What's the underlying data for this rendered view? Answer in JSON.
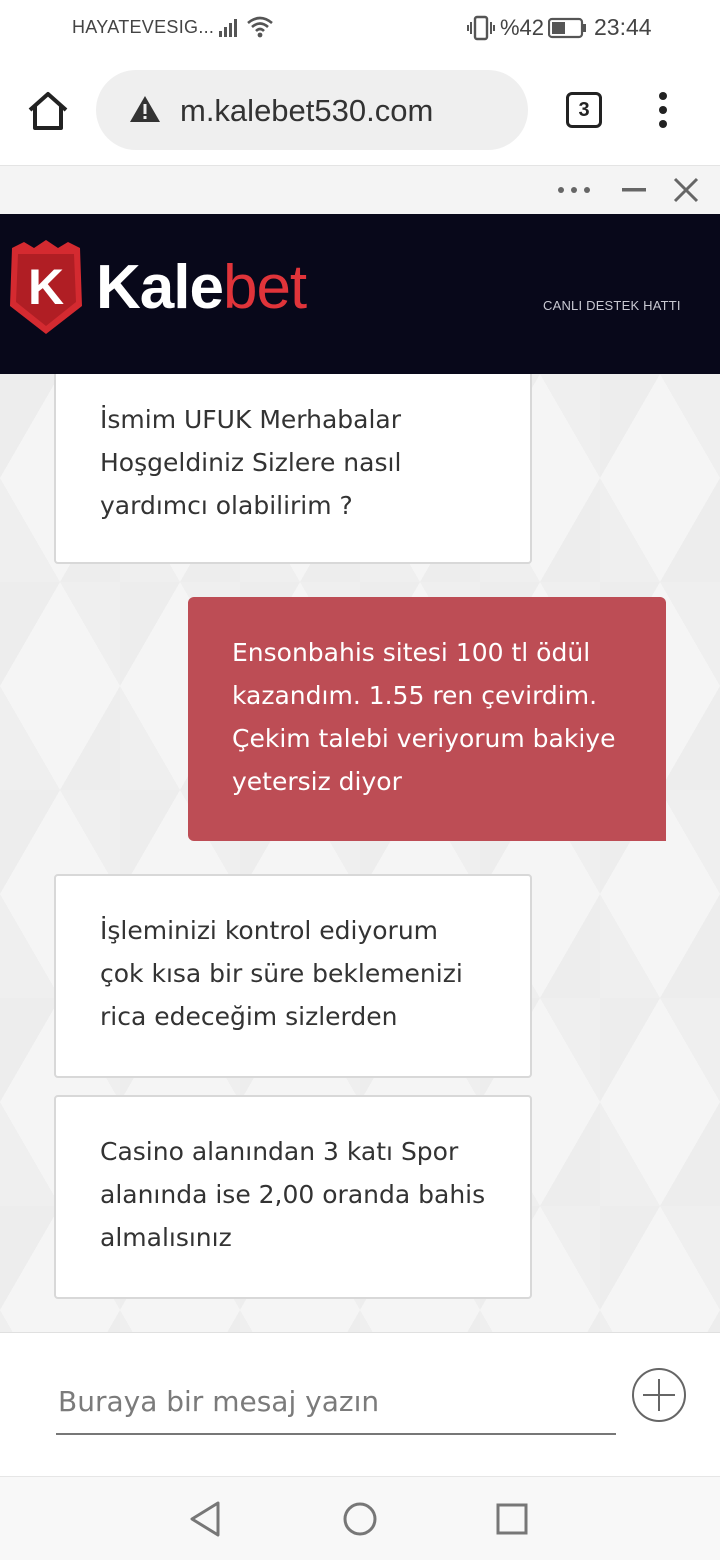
{
  "status_bar": {
    "carrier": "HAYATEVESIG...",
    "battery": "%42",
    "time": "23:44"
  },
  "browser": {
    "url": "m.kalebet530.com",
    "tab_count": "3"
  },
  "banner": {
    "logo_letter": "K",
    "logo_kale": "Kale",
    "logo_bet": "bet",
    "support_line": "CANLI DESTEK HATTI",
    "brand_red": "#e0343a",
    "background": "#08081a"
  },
  "chat": {
    "messages": [
      {
        "from": "agent",
        "text": "İsmim UFUK Merhabalar Hoşgeldiniz Sizlere nasıl yardımcı olabilirim ?"
      },
      {
        "from": "user",
        "text": "Ensonbahis sitesi 100 tl ödül kazandım. 1.55 ren çevirdim. Çekim talebi veriyorum bakiye yetersiz diyor"
      },
      {
        "from": "agent",
        "text": "İşleminizi kontrol ediyorum çok kısa bir süre beklemenizi rica edeceğim sizlerden"
      },
      {
        "from": "agent",
        "text": "Casino alanından 3 katı Spor alanında ise 2,00 oranda bahis almalısınız"
      }
    ],
    "user_bubble_color": "#bd4d55"
  },
  "composer": {
    "placeholder": "Buraya bir mesaj yazın"
  },
  "icons": {
    "home": "home-icon",
    "warning": "warning-icon",
    "menu": "more-vert-icon",
    "more": "more-horiz-icon",
    "minimize": "minimize-icon",
    "close": "close-icon",
    "attach": "plus-circle-icon",
    "back": "back-triangle-icon",
    "nav_home": "home-circle-icon",
    "recents": "recents-square-icon"
  }
}
